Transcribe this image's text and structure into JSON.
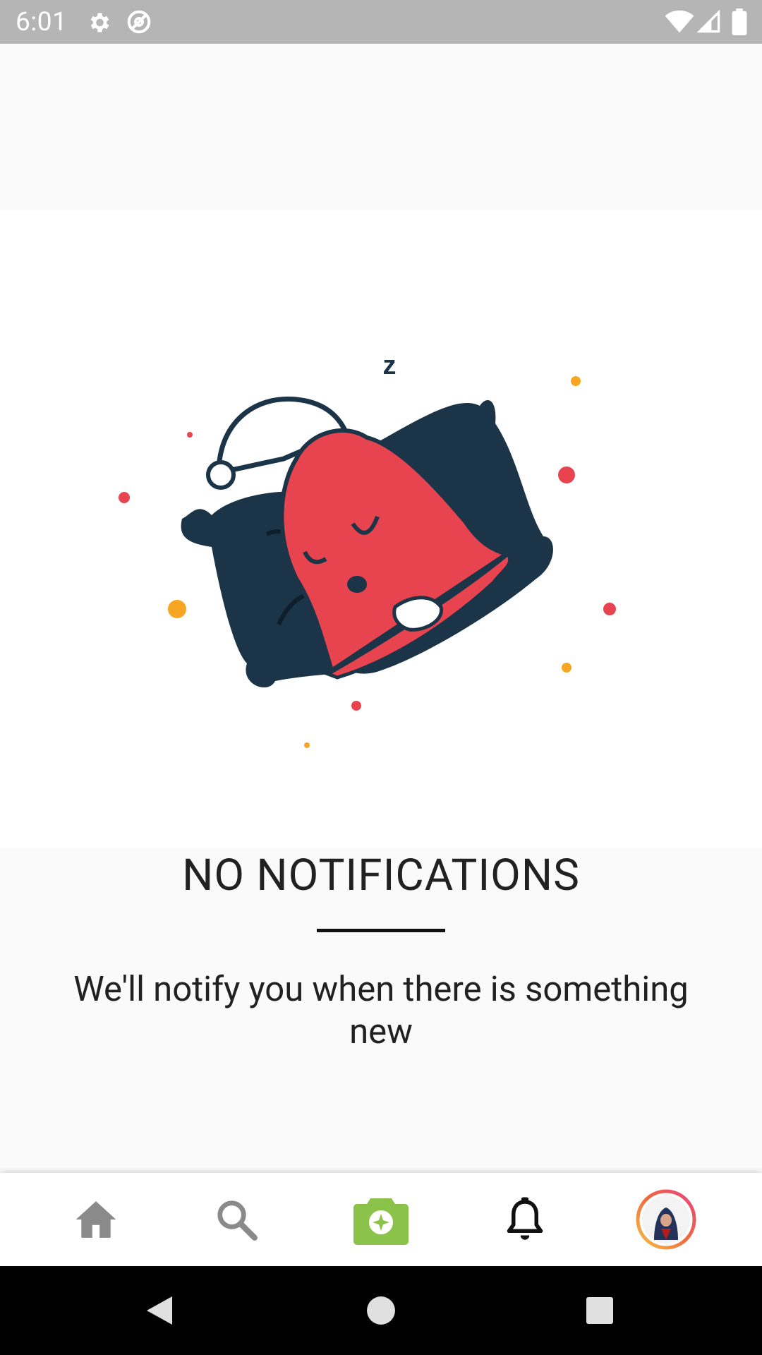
{
  "status_bar": {
    "time": "6:01",
    "icons": [
      "gear-icon",
      "at-sign-icon",
      "wifi-icon",
      "signal-icon",
      "battery-icon"
    ]
  },
  "empty_state": {
    "illustration": "sleeping-bell-icon",
    "title": "NO NOTIFICATIONS",
    "message": "We'll notify you when there is something new"
  },
  "bottom_nav": {
    "items": [
      {
        "name": "home",
        "icon": "home-icon"
      },
      {
        "name": "search",
        "icon": "search-icon"
      },
      {
        "name": "camera",
        "icon": "camera-icon"
      },
      {
        "name": "notifications",
        "icon": "bell-icon",
        "active": true
      },
      {
        "name": "profile",
        "icon": "avatar"
      }
    ]
  },
  "system_nav": {
    "buttons": [
      "back-icon",
      "home-circle-icon",
      "recents-icon"
    ]
  },
  "colors": {
    "status_bar": "#b5b5b5",
    "bell_red": "#e8444f",
    "pillow_navy": "#1b3447",
    "camera_green": "#8bc34a",
    "dot_orange": "#f6a623"
  }
}
